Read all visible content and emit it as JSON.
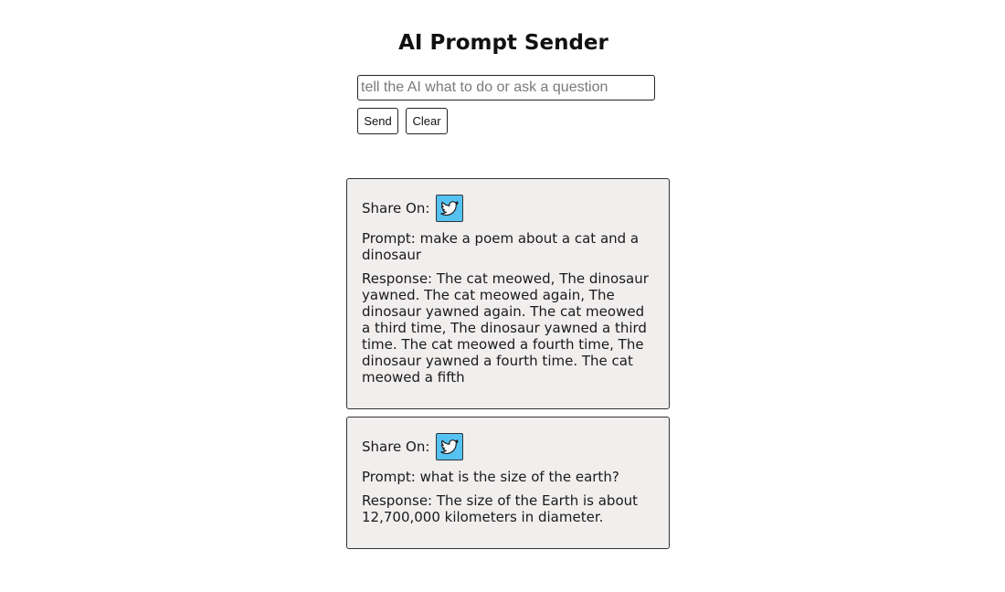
{
  "header": {
    "title": "AI Prompt Sender"
  },
  "form": {
    "placeholder": "tell the AI what to do or ask a question",
    "value": "",
    "send_label": "Send",
    "clear_label": "Clear"
  },
  "results": [
    {
      "share_label": "Share On:",
      "share_icon": "twitter-bird-icon",
      "prompt": "Prompt: make a poem about a cat and a dinosaur",
      "response": "Response: The cat meowed, The dinosaur yawned. The cat meowed again, The dinosaur yawned again. The cat meowed a third time, The dinosaur yawned a third time. The cat meowed a fourth time, The dinosaur yawned a fourth time. The cat meowed a fifth"
    },
    {
      "share_label": "Share On:",
      "share_icon": "twitter-bird-icon",
      "prompt": "Prompt: what is the size of the earth?",
      "response": "Response: The size of the Earth is about 12,700,000 kilometers in diameter."
    }
  ],
  "colors": {
    "card_background": "#f1eeee",
    "twitter_blue": "#55c2f2"
  }
}
